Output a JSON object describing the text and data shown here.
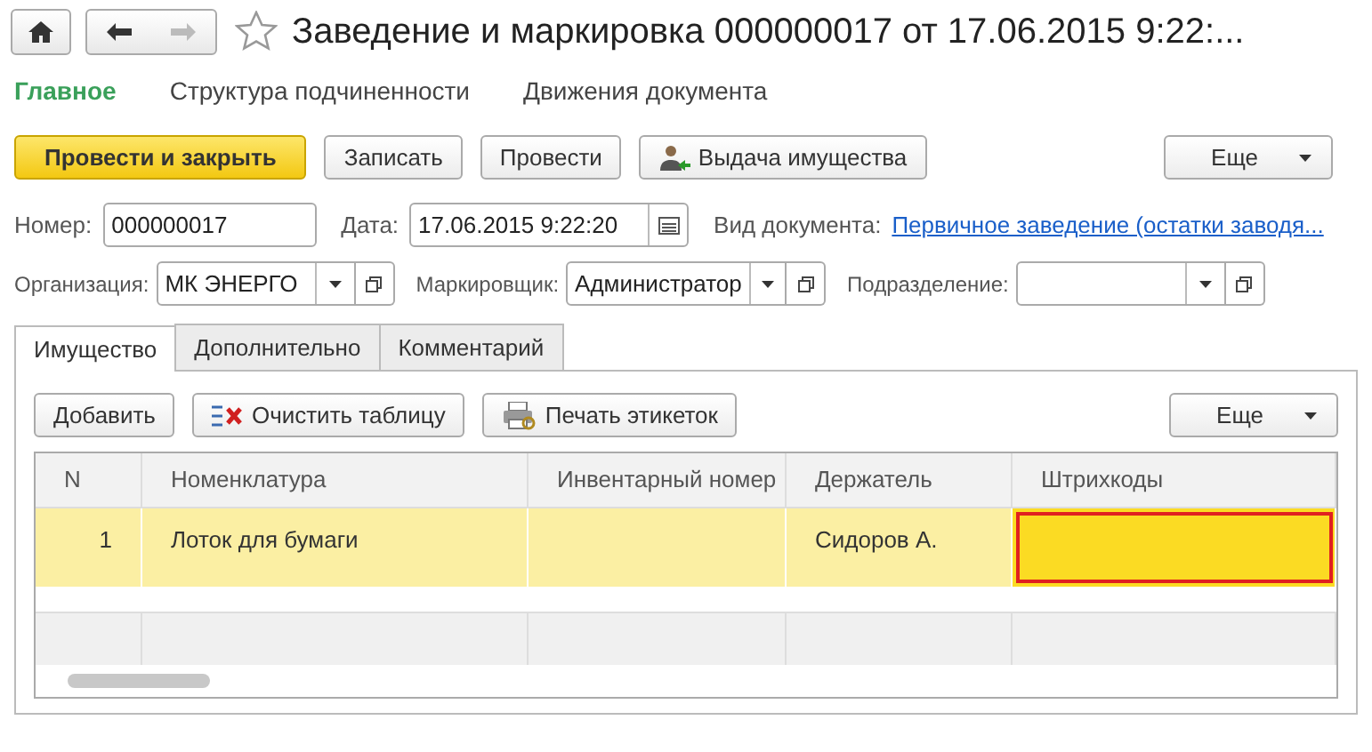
{
  "window": {
    "title": "Заведение и маркировка 000000017 от 17.06.2015 9:22:..."
  },
  "sections": [
    {
      "label": "Главное",
      "selected": true
    },
    {
      "label": "Структура подчиненности",
      "selected": false
    },
    {
      "label": "Движения документа",
      "selected": false
    }
  ],
  "toolbar": {
    "buttons": [
      {
        "label": "Провести и закрыть",
        "kind": "primary"
      },
      {
        "label": "Записать",
        "kind": "plain"
      },
      {
        "label": "Провести",
        "kind": "plain"
      },
      {
        "label": "Выдача имущества",
        "kind": "issue"
      }
    ],
    "more": "Еще"
  },
  "header_fields": [
    {
      "label": "Номер:",
      "value": "000000017",
      "kind": "text"
    },
    {
      "label": "Дата:",
      "value": "17.06.2015  9:22:20",
      "kind": "date"
    },
    {
      "label": "Вид документа:",
      "value": "Первичное заведение (остатки заводя...",
      "kind": "link"
    }
  ],
  "select_fields": [
    {
      "label": "Организация:",
      "value": "МК ЭНЕРГО"
    },
    {
      "label": "Маркировщик:",
      "value": "Администратор"
    },
    {
      "label": "Подразделение:"
    }
  ],
  "tabs": [
    {
      "label": "Имущество",
      "selected": true
    },
    {
      "label": "Дополнительно",
      "selected": false
    },
    {
      "label": "Комментарий",
      "selected": false
    }
  ],
  "table_toolbar": {
    "buttons": [
      {
        "label": "Добавить",
        "kind": "plain"
      },
      {
        "label": "Очистить таблицу",
        "kind": "clear"
      },
      {
        "label": "Печать этикеток",
        "kind": "print"
      }
    ],
    "more": "Еще"
  },
  "table": {
    "columns": [
      "N",
      "Номенклатура",
      "Инвентарный номер",
      "Держатель",
      "Штрихкоды"
    ],
    "rows": [
      {
        "selected": true,
        "cells": [
          {
            "text": "1",
            "focused": false
          },
          {
            "text": "Лоток для бумаги",
            "focused": false
          },
          {
            "focused": false
          },
          {
            "text": "Сидоров А.",
            "focused": false
          },
          {
            "focused": true
          }
        ]
      }
    ]
  }
}
